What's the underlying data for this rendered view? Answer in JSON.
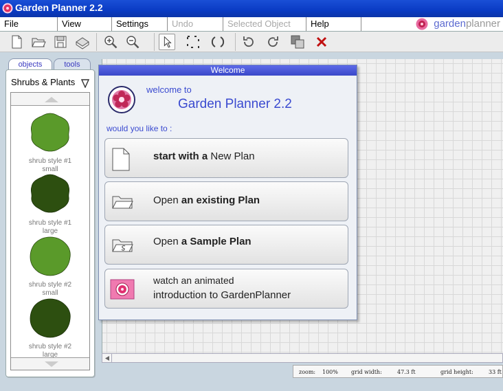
{
  "window": {
    "title": "Garden Planner 2.2"
  },
  "menu": {
    "file": "File",
    "view": "View",
    "settings": "Settings",
    "undo": "Undo",
    "selected_object": "Selected Object",
    "help": "Help"
  },
  "logo": {
    "part1": "garden",
    "part2": "planner"
  },
  "toolbar": {
    "icons": [
      "new-file-icon",
      "open-folder-icon",
      "save-icon",
      "print-icon",
      "zoom-in-icon",
      "zoom-out-icon",
      "pointer-icon",
      "marquee-select-icon",
      "rotate-icon",
      "rotate-left-icon",
      "rotate-right-icon",
      "bring-front-icon",
      "delete-icon"
    ]
  },
  "panel": {
    "tabs": [
      "objects",
      "tools"
    ],
    "category": "Shrubs & Plants",
    "items": [
      {
        "line1": "shrub style #1",
        "line2": "small",
        "color": "#5a9a2a"
      },
      {
        "line1": "shrub style #1",
        "line2": "large",
        "color": "#2d4f10"
      },
      {
        "line1": "shrub style #2",
        "line2": "small",
        "color": "#5a9a2a"
      },
      {
        "line1": "shrub style #2",
        "line2": "large",
        "color": "#2d4f10"
      }
    ]
  },
  "status": {
    "zoom_label": "zoom:",
    "zoom_value": "100%",
    "width_label": "grid width:",
    "width_value": "47.3 ft",
    "height_label": "grid height:",
    "height_value": "33 ft"
  },
  "dialog": {
    "title": "Welcome",
    "welcome_line": "welcome to",
    "app_name": "Garden Planner 2.2",
    "prompt": "would you like to :",
    "options": [
      {
        "a": "start with a ",
        "b": "New Plan"
      },
      {
        "a": "Open ",
        "b": "an existing Plan"
      },
      {
        "a": "Open ",
        "b": "a Sample Plan"
      },
      {
        "a": "watch an animated",
        "b": "introduction to GardenPlanner"
      }
    ]
  },
  "colors": {
    "titlebar": "#0a3bc4",
    "accent": "#3a4ad0",
    "dialog_title": "#4a58d8"
  }
}
